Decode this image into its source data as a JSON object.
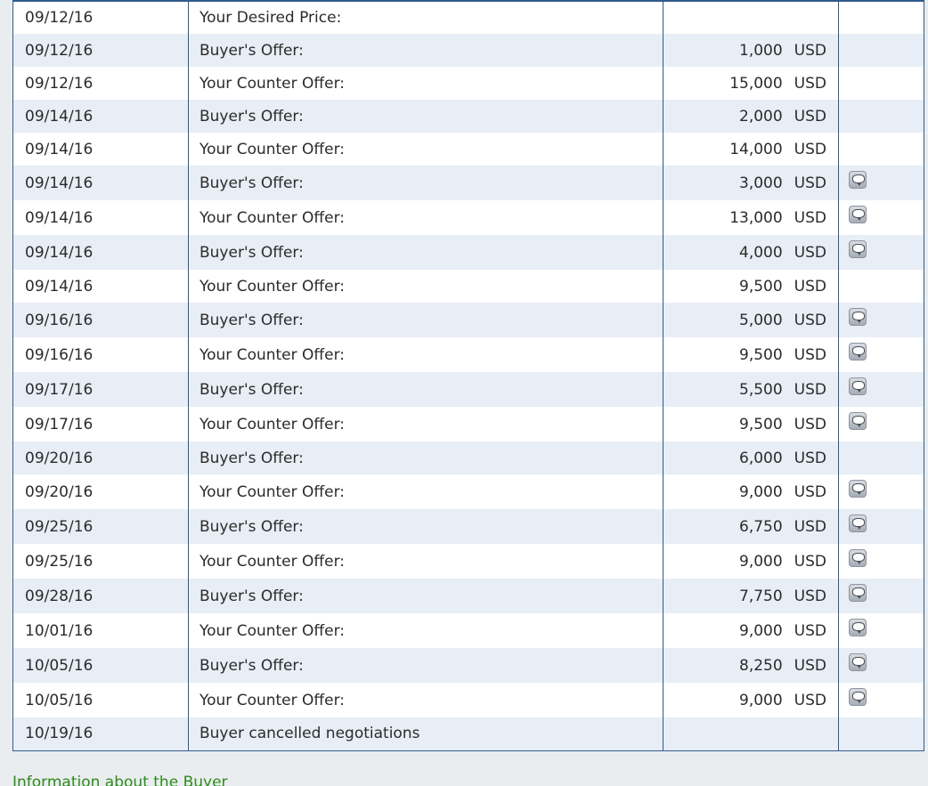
{
  "rows": [
    {
      "date": "09/12/16",
      "label": "Your Desired Price:",
      "amount": "",
      "currency": "",
      "comment": false
    },
    {
      "date": "09/12/16",
      "label": "Buyer's Offer:",
      "amount": "1,000",
      "currency": "USD",
      "comment": false
    },
    {
      "date": "09/12/16",
      "label": "Your Counter Offer:",
      "amount": "15,000",
      "currency": "USD",
      "comment": false
    },
    {
      "date": "09/14/16",
      "label": "Buyer's Offer:",
      "amount": "2,000",
      "currency": "USD",
      "comment": false
    },
    {
      "date": "09/14/16",
      "label": "Your Counter Offer:",
      "amount": "14,000",
      "currency": "USD",
      "comment": false
    },
    {
      "date": "09/14/16",
      "label": "Buyer's Offer:",
      "amount": "3,000",
      "currency": "USD",
      "comment": true
    },
    {
      "date": "09/14/16",
      "label": "Your Counter Offer:",
      "amount": "13,000",
      "currency": "USD",
      "comment": true
    },
    {
      "date": "09/14/16",
      "label": "Buyer's Offer:",
      "amount": "4,000",
      "currency": "USD",
      "comment": true
    },
    {
      "date": "09/14/16",
      "label": "Your Counter Offer:",
      "amount": "9,500",
      "currency": "USD",
      "comment": false
    },
    {
      "date": "09/16/16",
      "label": "Buyer's Offer:",
      "amount": "5,000",
      "currency": "USD",
      "comment": true
    },
    {
      "date": "09/16/16",
      "label": "Your Counter Offer:",
      "amount": "9,500",
      "currency": "USD",
      "comment": true
    },
    {
      "date": "09/17/16",
      "label": "Buyer's Offer:",
      "amount": "5,500",
      "currency": "USD",
      "comment": true
    },
    {
      "date": "09/17/16",
      "label": "Your Counter Offer:",
      "amount": "9,500",
      "currency": "USD",
      "comment": true
    },
    {
      "date": "09/20/16",
      "label": "Buyer's Offer:",
      "amount": "6,000",
      "currency": "USD",
      "comment": false
    },
    {
      "date": "09/20/16",
      "label": "Your Counter Offer:",
      "amount": "9,000",
      "currency": "USD",
      "comment": true
    },
    {
      "date": "09/25/16",
      "label": "Buyer's Offer:",
      "amount": "6,750",
      "currency": "USD",
      "comment": true
    },
    {
      "date": "09/25/16",
      "label": "Your Counter Offer:",
      "amount": "9,000",
      "currency": "USD",
      "comment": true
    },
    {
      "date": "09/28/16",
      "label": "Buyer's Offer:",
      "amount": "7,750",
      "currency": "USD",
      "comment": true
    },
    {
      "date": "10/01/16",
      "label": "Your Counter Offer:",
      "amount": "9,000",
      "currency": "USD",
      "comment": true
    },
    {
      "date": "10/05/16",
      "label": "Buyer's Offer:",
      "amount": "8,250",
      "currency": "USD",
      "comment": true
    },
    {
      "date": "10/05/16",
      "label": "Your Counter Offer:",
      "amount": "9,000",
      "currency": "USD",
      "comment": true
    },
    {
      "date": "10/19/16",
      "label": "Buyer cancelled negotiations",
      "amount": "",
      "currency": "",
      "comment": false
    }
  ],
  "comment_icon": "speech-bubble-icon",
  "info_link": "Information about the Buyer",
  "colors": {
    "border": "#2f5b8c",
    "row_alt": "#e8eef6",
    "row": "#ffffff",
    "link": "#2f8a1a",
    "page_bg": "#e9edf0"
  }
}
